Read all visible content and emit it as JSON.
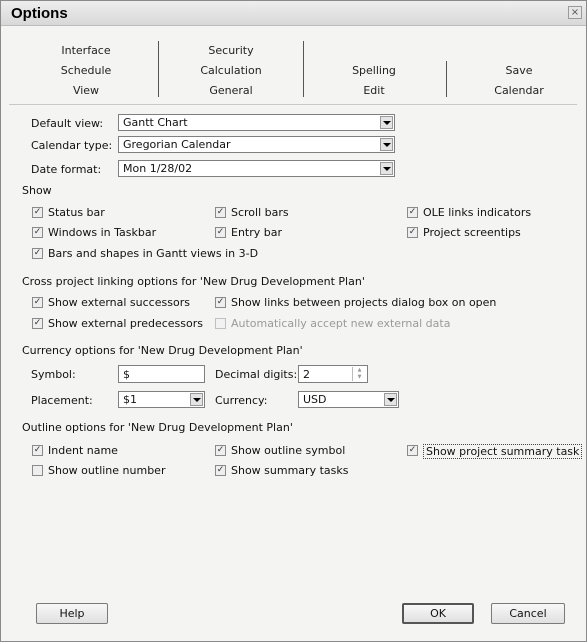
{
  "window": {
    "title": "Options",
    "close_symbol": "×"
  },
  "tabs": {
    "row1": [
      "Interface",
      "Security"
    ],
    "row2": [
      "Schedule",
      "Calculation",
      "Spelling",
      "Save"
    ],
    "row3": [
      "View",
      "General",
      "Edit",
      "Calendar"
    ],
    "selected": "View"
  },
  "view": {
    "default_view_label": "Default view:",
    "default_view_value": "Gantt Chart",
    "calendar_type_label": "Calendar type:",
    "calendar_type_value": "Gregorian Calendar",
    "date_format_label": "Date format:",
    "date_format_value": "Mon 1/28/02"
  },
  "show": {
    "heading": "Show",
    "status_bar": "Status bar",
    "windows_in_taskbar": "Windows in Taskbar",
    "bars_3d": "Bars and shapes in Gantt views in 3-D",
    "scroll_bars": "Scroll bars",
    "entry_bar": "Entry bar",
    "ole_links": "OLE links indicators",
    "project_screentips": "Project screentips"
  },
  "cross_project": {
    "heading": "Cross project linking options for 'New Drug Development Plan'",
    "show_external_successors": "Show external successors",
    "show_external_predecessors": "Show external predecessors",
    "show_links_dialog": "Show links between projects dialog box on open",
    "auto_accept": "Automatically accept new external data"
  },
  "currency": {
    "heading": "Currency options for 'New Drug Development Plan'",
    "symbol_label": "Symbol:",
    "symbol_value": "$",
    "decimal_label": "Decimal digits:",
    "decimal_value": "2",
    "placement_label": "Placement:",
    "placement_value": "$1",
    "currency_label": "Currency:",
    "currency_value": "USD"
  },
  "outline": {
    "heading": "Outline options for 'New Drug Development Plan'",
    "indent_name": "Indent name",
    "show_outline_number": "Show outline number",
    "show_outline_symbol": "Show outline symbol",
    "show_summary_tasks": "Show summary tasks",
    "show_project_summary_task": "Show project summary task"
  },
  "buttons": {
    "help": "Help",
    "ok": "OK",
    "cancel": "Cancel"
  },
  "check_glyph": "✓"
}
